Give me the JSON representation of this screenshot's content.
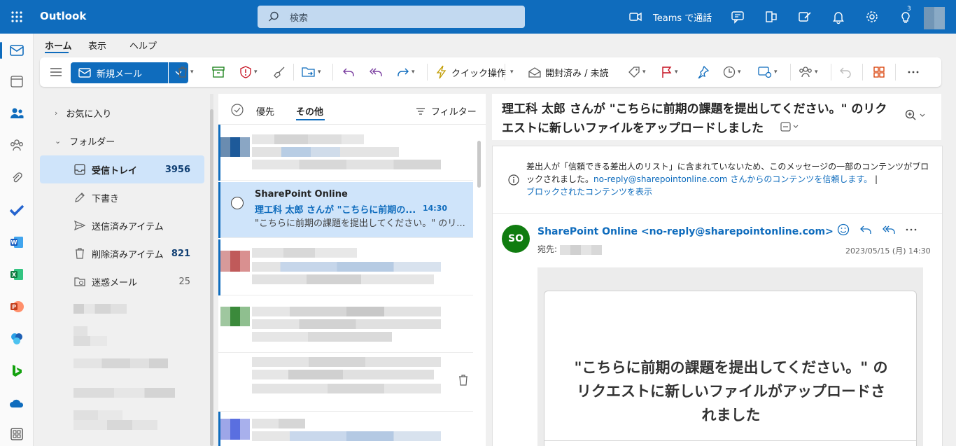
{
  "app": {
    "name": "Outlook"
  },
  "search": {
    "placeholder": "検索"
  },
  "topbar": {
    "teams_call": "Teams で通話",
    "notification_badge": "3"
  },
  "tabs": [
    {
      "label": "ホーム"
    },
    {
      "label": "表示"
    },
    {
      "label": "ヘルプ"
    }
  ],
  "ribbon": {
    "new_mail": "新規メール",
    "quick_steps": "クイック操作",
    "read_unread": "開封済み / 未読"
  },
  "folders": {
    "favorites": "お気に入り",
    "folders": "フォルダー",
    "items": [
      {
        "label": "受信トレイ",
        "count": "3956"
      },
      {
        "label": "下書き",
        "count": ""
      },
      {
        "label": "送信済みアイテム",
        "count": ""
      },
      {
        "label": "削除済みアイテム",
        "count": "821"
      },
      {
        "label": "迷惑メール",
        "count": "25"
      }
    ]
  },
  "message_list": {
    "focused": "優先",
    "other": "その他",
    "filter": "フィルター",
    "selected": {
      "sender": "SharePoint Online",
      "subject": "理工科 太郎 さんが \"こちらに前期の...",
      "time": "14:30",
      "preview": "\"こちらに前期の課題を提出してください。\" のリ..."
    }
  },
  "reading": {
    "title": "理工科 太郎 さんが \"こちらに前期の課題を提出してください。\" のリクエストに新しいファイルをアップロードしました",
    "warning_text": "差出人が「信頼できる差出人のリスト」に含まれていないため、このメッセージの一部のコンテンツがブロックされました。",
    "trust_link": "no-reply@sharepointonline.com さんからのコンテンツを信頼します。",
    "separator": "|",
    "show_blocked": "ブロックされたコンテンツを表示",
    "avatar": "SO",
    "from": "SharePoint Online <no-reply@sharepointonline.com>",
    "to_label": "宛先:",
    "date": "2023/05/15 (月) 14:30",
    "card_text": "\"こちらに前期の課題を提出してください。\" のリクエストに新しいファイルがアップロードされました"
  }
}
